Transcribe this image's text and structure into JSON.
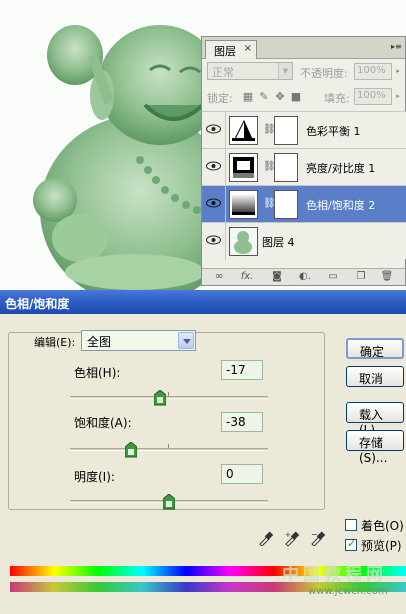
{
  "layers_panel": {
    "tab_label": "图层",
    "close_glyph": "×",
    "blend_mode": "正常",
    "opacity_label": "不透明度:",
    "opacity_value": "100%",
    "lock_label": "锁定:",
    "fill_label": "填充:",
    "fill_value": "100%",
    "layers": [
      {
        "name": "色彩平衡 1",
        "type": "adjustment",
        "thumb_icon": "color-balance-icon",
        "selected": false
      },
      {
        "name": "亮度/对比度 1",
        "type": "adjustment",
        "thumb_icon": "brightness-contrast-icon",
        "selected": false
      },
      {
        "name": "色相/饱和度 2",
        "type": "adjustment",
        "thumb_icon": "hue-saturation-icon",
        "selected": true
      },
      {
        "name": "图层 4",
        "type": "pixel",
        "thumb_icon": "statue-thumbnail",
        "selected": false
      }
    ],
    "bottom_icons": [
      "link-icon",
      "fx-icon",
      "mask-icon",
      "adjustment-icon",
      "group-icon",
      "new-layer-icon",
      "trash-icon"
    ]
  },
  "dialog": {
    "title": "色相/饱和度",
    "edit_label": "编辑(E):",
    "edit_value": "全图",
    "hue_label": "色相(H):",
    "hue_value": "-17",
    "hue_level": -17,
    "saturation_label": "饱和度(A):",
    "saturation_value": "-38",
    "saturation_level": -38,
    "lightness_label": "明度(I):",
    "lightness_value": "0",
    "lightness_level": 0,
    "buttons": {
      "ok": "确定",
      "cancel": "取消",
      "load": "载入(L)...",
      "save": "存储(S)..."
    },
    "colorize_label": "着色(O)",
    "colorize_checked": false,
    "preview_label": "预览(P)",
    "preview_checked": true
  },
  "watermark": {
    "text": "中国教程网",
    "url": "www.jcwcn.com"
  },
  "colors": {
    "title_bar": "#2f5fc6",
    "selected_layer": "#5a7fc8",
    "dialog_bg": "#ece9d8",
    "statue_green": "#8fbf8f"
  }
}
